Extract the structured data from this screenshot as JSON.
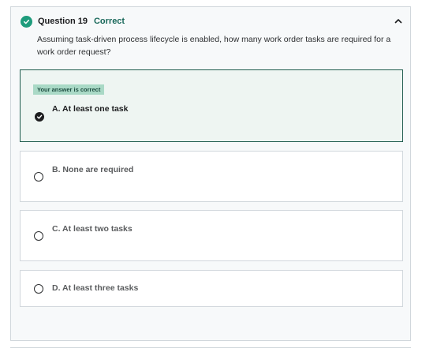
{
  "question": {
    "number_label": "Question 19",
    "status_label": "Correct",
    "text": "Assuming task-driven process lifecycle is enabled, how many work order tasks are required for a work order request?",
    "icons": {
      "status": "check-circle-icon",
      "collapse": "chevron-up-icon"
    }
  },
  "colors": {
    "correct_accent": "#1e9c7c",
    "correct_border": "#1e5b4d",
    "correct_background": "#eef5f2",
    "badge_background": "#a9d9c6"
  },
  "options": [
    {
      "label": "A. At least one task",
      "selected": true,
      "correct_badge": "Your answer is correct"
    },
    {
      "label": "B. None are required",
      "selected": false
    },
    {
      "label": "C. At least two tasks",
      "selected": false
    },
    {
      "label": "D. At least three tasks",
      "selected": false
    }
  ]
}
